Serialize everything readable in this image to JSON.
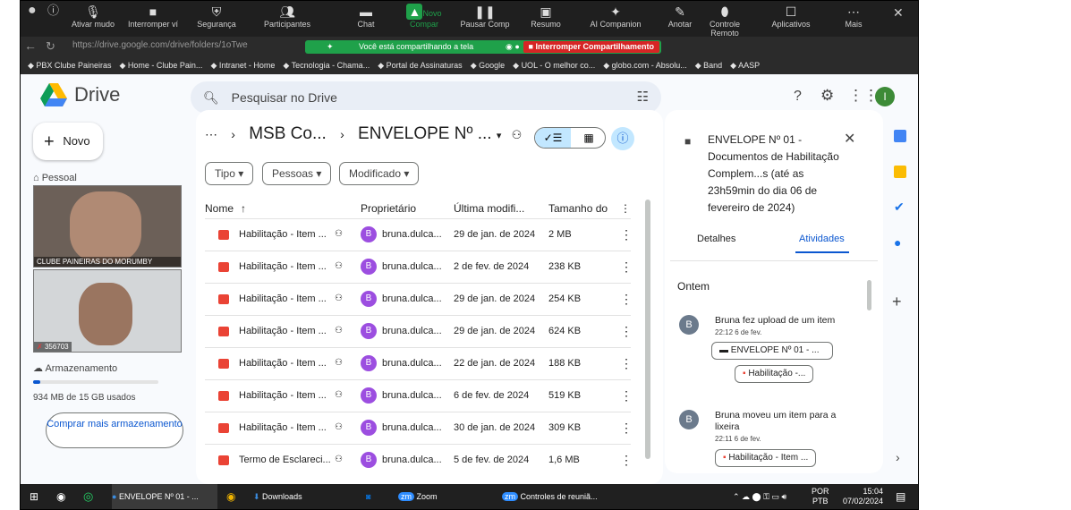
{
  "zoom": {
    "buttons": [
      {
        "label": "Ativar mudo",
        "icon": "mic-icon"
      },
      {
        "label": "Interromper ví",
        "icon": "video-icon"
      },
      {
        "label": "Segurança",
        "icon": "shield-icon"
      },
      {
        "label": "Participantes",
        "icon": "participants-icon",
        "count": "2"
      },
      {
        "label": "Chat",
        "icon": "chat-icon"
      },
      {
        "label": "Novo Compar",
        "icon": "share-icon"
      },
      {
        "label": "Pausar Comp",
        "icon": "pause-icon"
      },
      {
        "label": "Resumo",
        "icon": "summary-icon"
      },
      {
        "label": "AI Companion",
        "icon": "ai-icon"
      },
      {
        "label": "Anotar",
        "icon": "pen-icon"
      },
      {
        "label": "Controle Remoto",
        "icon": "remote-icon"
      },
      {
        "label": "Aplicativos",
        "icon": "apps-icon"
      },
      {
        "label": "Mais",
        "icon": "more-icon"
      }
    ],
    "sharing_text": "Você está compartilhando a tela",
    "stop_label": "Interromper Compartilhamento",
    "accent": "#1fa14a"
  },
  "browser": {
    "url": "https://drive.google.com/drive/folders/1oTwe",
    "bookmarks": [
      "PBX Clube Paineiras",
      "Home - Clube Pain...",
      "Intranet - Home",
      "Tecnologia - Chama...",
      "Portal de Assinaturas",
      "Google",
      "UOL - O melhor co...",
      "globo.com - Absolu...",
      "Band",
      "AASP"
    ]
  },
  "drive": {
    "logo": "Drive",
    "search_placeholder": "Pesquisar no Drive",
    "new_label": "Novo",
    "sidebar_label": "Pessoal",
    "storage_label": "Armazenamento",
    "storage_used": "934 MB de 15 GB usados",
    "storage_fraction": 0.06,
    "buy_label": "Comprar mais armazenamento",
    "crumb": [
      "MSB Co...",
      "ENVELOPE Nº ..."
    ],
    "chips": [
      "Tipo",
      "Pessoas",
      "Modificado"
    ],
    "columns": [
      "Nome",
      "Proprietário",
      "Última modifi...",
      "Tamanho do"
    ],
    "files": [
      {
        "name": "Habilitação - Item ...",
        "owner": "bruna.dulca...",
        "date": "29 de jan. de 2024",
        "size": "2 MB"
      },
      {
        "name": "Habilitação - Item ...",
        "owner": "bruna.dulca...",
        "date": "2 de fev. de 2024",
        "size": "238 KB"
      },
      {
        "name": "Habilitação - Item ...",
        "owner": "bruna.dulca...",
        "date": "29 de jan. de 2024",
        "size": "254 KB"
      },
      {
        "name": "Habilitação - Item ...",
        "owner": "bruna.dulca...",
        "date": "29 de jan. de 2024",
        "size": "624 KB"
      },
      {
        "name": "Habilitação - Item ...",
        "owner": "bruna.dulca...",
        "date": "22 de jan. de 2024",
        "size": "188 KB"
      },
      {
        "name": "Habilitação - Item ...",
        "owner": "bruna.dulca...",
        "date": "6 de fev. de 2024",
        "size": "519 KB"
      },
      {
        "name": "Habilitação - Item ...",
        "owner": "bruna.dulca...",
        "date": "30 de jan. de 2024",
        "size": "309 KB"
      },
      {
        "name": "Termo de Esclareci...",
        "owner": "bruna.dulca...",
        "date": "5 de fev. de 2024",
        "size": "1,6 MB"
      }
    ],
    "details": {
      "title": "ENVELOPE Nº 01 - Documentos de Habilitação Complem...s (até as 23h59min do dia 06 de fevereiro de 2024)",
      "tabs": [
        "Detalhes",
        "Atividades"
      ],
      "section": "Ontem",
      "activity": [
        {
          "text": "Bruna fez upload de um item",
          "time": "22:12 6 de fev.",
          "folder": "ENVELOPE Nº 01 - ...",
          "file": "Habilitação -..."
        },
        {
          "text": "Bruna moveu um item para a lixeira",
          "time": "22:11 6 de fev.",
          "file": "Habilitação - Item ..."
        }
      ]
    }
  },
  "video": {
    "name1": "CLUBE PAINEIRAS DO MORUMBY",
    "name2": "356703"
  },
  "taskbar": {
    "items": [
      "ENVELOPE Nº 01 - ...",
      "Downloads",
      "Zoom",
      "Controles de reuniã..."
    ],
    "lang": "POR",
    "layout": "PTB",
    "time": "15:04",
    "date": "07/02/2024"
  }
}
